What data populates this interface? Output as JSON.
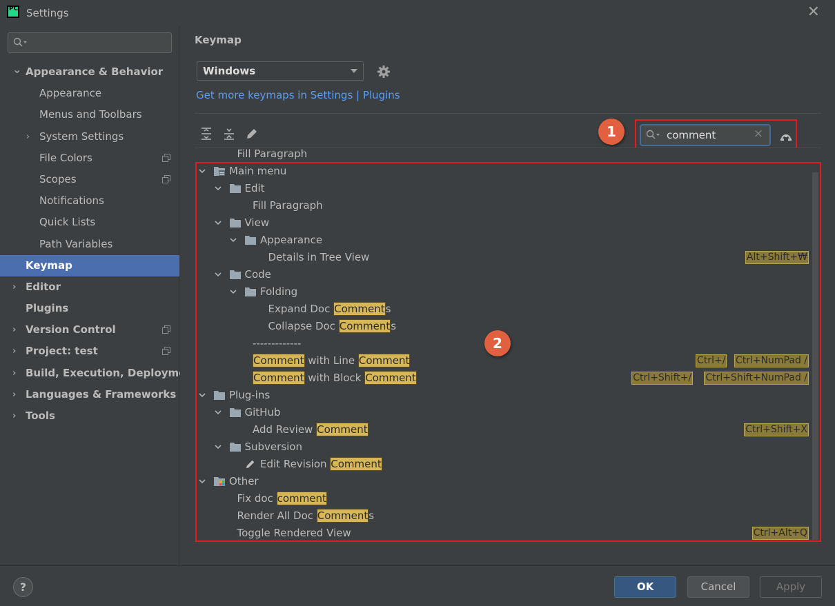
{
  "window": {
    "title": "Settings",
    "close_label": "✕"
  },
  "sidebar": {
    "search_placeholder": "",
    "items": [
      {
        "label": "Appearance & Behavior",
        "level": 0,
        "bold": true,
        "expander": "expanded",
        "copy": false,
        "selected": false
      },
      {
        "label": "Appearance",
        "level": 1,
        "bold": false,
        "expander": "none",
        "copy": false,
        "selected": false
      },
      {
        "label": "Menus and Toolbars",
        "level": 1,
        "bold": false,
        "expander": "none",
        "copy": false,
        "selected": false
      },
      {
        "label": "System Settings",
        "level": 1,
        "bold": false,
        "expander": "collapsed",
        "copy": false,
        "selected": false
      },
      {
        "label": "File Colors",
        "level": 1,
        "bold": false,
        "expander": "none",
        "copy": true,
        "selected": false
      },
      {
        "label": "Scopes",
        "level": 1,
        "bold": false,
        "expander": "none",
        "copy": true,
        "selected": false
      },
      {
        "label": "Notifications",
        "level": 1,
        "bold": false,
        "expander": "none",
        "copy": false,
        "selected": false
      },
      {
        "label": "Quick Lists",
        "level": 1,
        "bold": false,
        "expander": "none",
        "copy": false,
        "selected": false
      },
      {
        "label": "Path Variables",
        "level": 1,
        "bold": false,
        "expander": "none",
        "copy": false,
        "selected": false
      },
      {
        "label": "Keymap",
        "level": 0,
        "bold": true,
        "expander": "none",
        "copy": false,
        "selected": true
      },
      {
        "label": "Editor",
        "level": 0,
        "bold": true,
        "expander": "collapsed",
        "copy": false,
        "selected": false
      },
      {
        "label": "Plugins",
        "level": 0,
        "bold": true,
        "expander": "none",
        "copy": false,
        "selected": false
      },
      {
        "label": "Version Control",
        "level": 0,
        "bold": true,
        "expander": "collapsed",
        "copy": true,
        "selected": false
      },
      {
        "label": "Project: test",
        "level": 0,
        "bold": true,
        "expander": "collapsed",
        "copy": true,
        "selected": false
      },
      {
        "label": "Build, Execution, Deployment",
        "level": 0,
        "bold": true,
        "expander": "collapsed",
        "copy": false,
        "selected": false
      },
      {
        "label": "Languages & Frameworks",
        "level": 0,
        "bold": true,
        "expander": "collapsed",
        "copy": false,
        "selected": false
      },
      {
        "label": "Tools",
        "level": 0,
        "bold": true,
        "expander": "collapsed",
        "copy": false,
        "selected": false
      }
    ]
  },
  "main": {
    "heading": "Keymap",
    "keymap_select": "Windows",
    "link_text": "Get more keymaps in Settings | Plugins",
    "search_value": "comment",
    "search_clear": "×",
    "callout_1": "1",
    "callout_2": "2"
  },
  "tree": [
    {
      "level": 1,
      "expander": "none",
      "icon": "none",
      "parts": [
        {
          "t": "Fill Paragraph",
          "hl": false
        }
      ],
      "shortcuts": []
    },
    {
      "level": 0,
      "expander": "expanded",
      "icon": "menu-folder",
      "parts": [
        {
          "t": "Main menu",
          "hl": false
        }
      ],
      "shortcuts": []
    },
    {
      "level": 1,
      "expander": "expanded",
      "icon": "folder",
      "parts": [
        {
          "t": "Edit",
          "hl": false
        }
      ],
      "shortcuts": []
    },
    {
      "level": 2,
      "expander": "none",
      "icon": "none",
      "parts": [
        {
          "t": "Fill Paragraph",
          "hl": false
        }
      ],
      "shortcuts": []
    },
    {
      "level": 1,
      "expander": "expanded",
      "icon": "folder",
      "parts": [
        {
          "t": "View",
          "hl": false
        }
      ],
      "shortcuts": []
    },
    {
      "level": 2,
      "expander": "expanded",
      "icon": "folder",
      "parts": [
        {
          "t": "Appearance",
          "hl": false
        }
      ],
      "shortcuts": []
    },
    {
      "level": 3,
      "expander": "none",
      "icon": "none",
      "parts": [
        {
          "t": "Details in Tree View",
          "hl": false
        }
      ],
      "shortcuts": [
        "Alt+Shift+₩"
      ]
    },
    {
      "level": 1,
      "expander": "expanded",
      "icon": "folder",
      "parts": [
        {
          "t": "Code",
          "hl": false
        }
      ],
      "shortcuts": []
    },
    {
      "level": 2,
      "expander": "expanded",
      "icon": "folder",
      "parts": [
        {
          "t": "Folding",
          "hl": false
        }
      ],
      "shortcuts": []
    },
    {
      "level": 3,
      "expander": "none",
      "icon": "none",
      "parts": [
        {
          "t": "Expand Doc ",
          "hl": false
        },
        {
          "t": "Comment",
          "hl": true
        },
        {
          "t": "s",
          "hl": false
        }
      ],
      "shortcuts": []
    },
    {
      "level": 3,
      "expander": "none",
      "icon": "none",
      "parts": [
        {
          "t": "Collapse Doc ",
          "hl": false
        },
        {
          "t": "Comment",
          "hl": true
        },
        {
          "t": "s",
          "hl": false
        }
      ],
      "shortcuts": []
    },
    {
      "level": 2,
      "expander": "none",
      "icon": "none",
      "parts": [
        {
          "t": "-------------",
          "hl": false
        }
      ],
      "shortcuts": []
    },
    {
      "level": 2,
      "expander": "none",
      "icon": "none",
      "parts": [
        {
          "t": "Comment",
          "hl": true
        },
        {
          "t": " with Line ",
          "hl": false
        },
        {
          "t": "Comment",
          "hl": true
        }
      ],
      "shortcuts": [
        "Ctrl+/",
        "Ctrl+NumPad /"
      ]
    },
    {
      "level": 2,
      "expander": "none",
      "icon": "none",
      "parts": [
        {
          "t": "Comment",
          "hl": true
        },
        {
          "t": " with Block ",
          "hl": false
        },
        {
          "t": "Comment",
          "hl": true
        }
      ],
      "shortcuts": [
        "Ctrl+Shift+/",
        "Ctrl+Shift+NumPad /"
      ]
    },
    {
      "level": 0,
      "expander": "expanded",
      "icon": "folder",
      "parts": [
        {
          "t": "Plug-ins",
          "hl": false
        }
      ],
      "shortcuts": []
    },
    {
      "level": 1,
      "expander": "expanded",
      "icon": "folder",
      "parts": [
        {
          "t": "GitHub",
          "hl": false
        }
      ],
      "shortcuts": []
    },
    {
      "level": 2,
      "expander": "none",
      "icon": "none",
      "parts": [
        {
          "t": "Add Review ",
          "hl": false
        },
        {
          "t": "Comment",
          "hl": true
        }
      ],
      "shortcuts": [
        "Ctrl+Shift+X"
      ]
    },
    {
      "level": 1,
      "expander": "expanded",
      "icon": "folder",
      "parts": [
        {
          "t": "Subversion",
          "hl": false
        }
      ],
      "shortcuts": []
    },
    {
      "level": 2,
      "expander": "none",
      "icon": "pencil",
      "parts": [
        {
          "t": "Edit Revision ",
          "hl": false
        },
        {
          "t": "Comment",
          "hl": true
        }
      ],
      "shortcuts": []
    },
    {
      "level": 0,
      "expander": "expanded",
      "icon": "other-folder",
      "parts": [
        {
          "t": "Other",
          "hl": false
        }
      ],
      "shortcuts": []
    },
    {
      "level": 1,
      "expander": "none",
      "icon": "none",
      "parts": [
        {
          "t": "Fix doc ",
          "hl": false
        },
        {
          "t": "comment",
          "hl": true
        }
      ],
      "shortcuts": []
    },
    {
      "level": 1,
      "expander": "none",
      "icon": "none",
      "parts": [
        {
          "t": "Render All Doc ",
          "hl": false
        },
        {
          "t": "Comment",
          "hl": true
        },
        {
          "t": "s",
          "hl": false
        }
      ],
      "shortcuts": []
    },
    {
      "level": 1,
      "expander": "none",
      "icon": "none",
      "parts": [
        {
          "t": "Toggle Rendered View",
          "hl": false
        }
      ],
      "shortcuts": [
        "Ctrl+Alt+Q"
      ]
    }
  ],
  "footer": {
    "help": "?",
    "ok": "OK",
    "cancel": "Cancel",
    "apply": "Apply"
  },
  "colors": {
    "accent": "#4b6eaf",
    "highlight": "#d6b656",
    "link": "#589df6",
    "callout": "#e06040",
    "annotation_box": "#e31c23"
  }
}
